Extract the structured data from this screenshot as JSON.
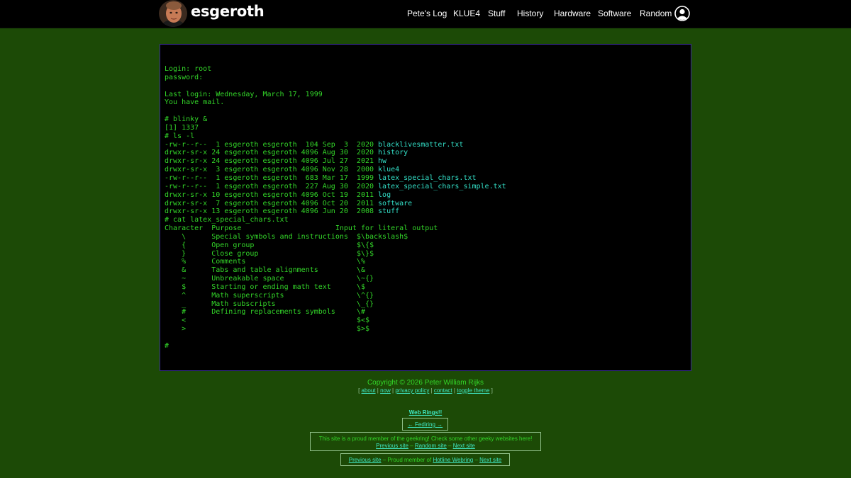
{
  "header": {
    "brand": "esgeroth",
    "nav": [
      "Pete's Log",
      "KLUE4",
      "Stuff",
      "History",
      "Hardware",
      "Software",
      "Random"
    ]
  },
  "terminal": {
    "lines": [
      [
        {
          "t": "Login: root"
        }
      ],
      [
        {
          "t": "password:"
        }
      ],
      [
        {
          "t": ""
        }
      ],
      [
        {
          "t": "Last login: Wednesday, March 17, 1999"
        }
      ],
      [
        {
          "t": "You have mail."
        }
      ],
      [
        {
          "t": ""
        }
      ],
      [
        {
          "t": "# blinky &"
        }
      ],
      [
        {
          "t": "[1] 1337"
        }
      ],
      [
        {
          "t": "# ls -l"
        }
      ],
      [
        {
          "t": "-rw-r--r--  1 esgeroth esgeroth  104 Sep  3  2020 "
        },
        {
          "t": "blacklivesmatter.txt",
          "link": true
        }
      ],
      [
        {
          "t": "drwxr-sr-x 24 esgeroth esgeroth 4096 Aug 30  2020 "
        },
        {
          "t": "history",
          "link": true
        }
      ],
      [
        {
          "t": "drwxr-sr-x 24 esgeroth esgeroth 4096 Jul 27  2021 "
        },
        {
          "t": "hw",
          "link": true
        }
      ],
      [
        {
          "t": "drwxr-sr-x  3 esgeroth esgeroth 4096 Nov 28  2000 "
        },
        {
          "t": "klue4",
          "link": true
        }
      ],
      [
        {
          "t": "-rw-r--r--  1 esgeroth esgeroth  683 Mar 17  1999 "
        },
        {
          "t": "latex_special_chars.txt",
          "link": true
        }
      ],
      [
        {
          "t": "-rw-r--r--  1 esgeroth esgeroth  227 Aug 30  2020 "
        },
        {
          "t": "latex_special_chars_simple.txt",
          "link": true
        }
      ],
      [
        {
          "t": "drwxr-sr-x 10 esgeroth esgeroth 4096 Oct 19  2011 "
        },
        {
          "t": "log",
          "link": true
        }
      ],
      [
        {
          "t": "drwxr-sr-x  7 esgeroth esgeroth 4096 Oct 20  2011 "
        },
        {
          "t": "software",
          "link": true
        }
      ],
      [
        {
          "t": "drwxr-sr-x 13 esgeroth esgeroth 4096 Jun 20  2008 "
        },
        {
          "t": "stuff",
          "link": true
        }
      ],
      [
        {
          "t": "# cat latex_special_chars.txt"
        }
      ],
      [
        {
          "t": "Character  Purpose                      Input for literal output"
        }
      ],
      [
        {
          "t": "    \\      Special symbols and instructions  $\\backslash$"
        }
      ],
      [
        {
          "t": "    {      Open group                        $\\{$"
        }
      ],
      [
        {
          "t": "    }      Close group                       $\\}$"
        }
      ],
      [
        {
          "t": "    %      Comments                          \\%"
        }
      ],
      [
        {
          "t": "    &      Tabs and table alignments         \\&"
        }
      ],
      [
        {
          "t": "    ~      Unbreakable space                 \\~{}"
        }
      ],
      [
        {
          "t": "    $      Starting or ending math text      \\$"
        }
      ],
      [
        {
          "t": "    ^      Math superscripts                 \\^{}"
        }
      ],
      [
        {
          "t": "    _      Math subscripts                   \\_{}"
        }
      ],
      [
        {
          "t": "    #      Defining replacements symbols     \\#"
        }
      ],
      [
        {
          "t": "    <                                        $<$"
        }
      ],
      [
        {
          "t": "    >                                        $>$"
        }
      ],
      [
        {
          "t": ""
        }
      ],
      [
        {
          "t": "#"
        }
      ]
    ]
  },
  "footer": {
    "copyright": "Copyright © 2026 Peter William Rijks",
    "bracket_open": "[ ",
    "bracket_close": " ]",
    "sep": " | ",
    "links": [
      "about",
      "now",
      "privacy policy",
      "contact",
      "toggle theme"
    ],
    "webrings_title": "Web Rings!!",
    "fediring": "← Fediring →",
    "geekring_text": "This site is a proud member of the geekring! Check some other geeky websites here!",
    "geekring_prev": "Previous site",
    "geekring_random": "Random site",
    "geekring_next": "Next site",
    "dash": " – ",
    "hotline_prev": "Previous site",
    "hotline_mid": " – Proud member of ",
    "hotline_name": "Hotline Webring",
    "hotline_end": " – ",
    "hotline_next": "Next site"
  },
  "colors": {
    "background": "#1c4a06",
    "terminal_text": "#33d629",
    "link": "#3fe6c2"
  }
}
